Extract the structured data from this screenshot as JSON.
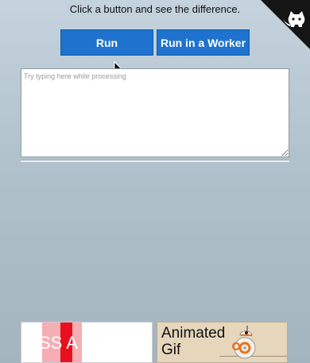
{
  "header": {
    "instruction": "Click a button and see the difference."
  },
  "buttons": {
    "run_label": "Run",
    "worker_label": "Run in a Worker"
  },
  "input": {
    "placeholder": "Try typing here while processing",
    "value": ""
  },
  "animations": {
    "css_text": "SS A",
    "gif_text": "Animated Gif"
  },
  "colors": {
    "button": "#1f73cf",
    "stripe_light": "#f5aeb3",
    "stripe_red": "#e8101f",
    "gif_background": "#e6d6bc"
  },
  "icons": {
    "corner": "github-cat-icon",
    "cursor": "mouse-pointer-icon",
    "droid": "bb8-droid-icon"
  }
}
